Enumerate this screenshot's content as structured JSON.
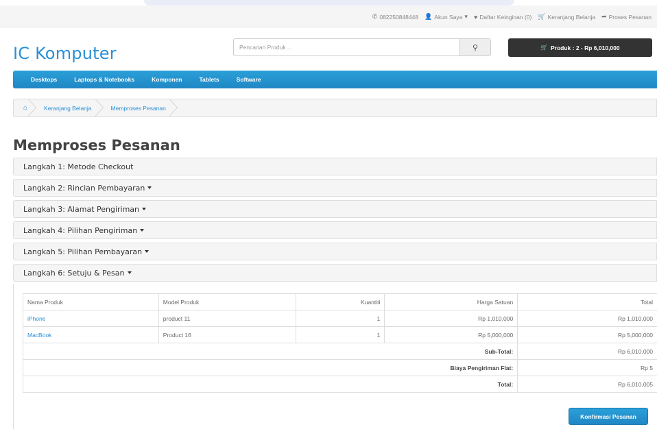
{
  "topbar": {
    "phone": "082250848448",
    "account": "Akun Saya",
    "wishlist": "Daftar Keinginan (0)",
    "cart": "Keranjang Belanja",
    "checkout": "Proses Pesanan"
  },
  "header": {
    "logo": "IC Komputer",
    "search_placeholder": "Pencarian Produk ...",
    "cart_summary": "Produk : 2 - Rp 6,010,000"
  },
  "menu": [
    "Desktops",
    "Laptops & Notebooks",
    "Komponen",
    "Tablets",
    "Software"
  ],
  "breadcrumb": [
    "Keranjang Belanja",
    "Memproses Pesanan"
  ],
  "page_title": "Memproses Pesanan",
  "steps": [
    {
      "label": "Langkah 1: Metode Checkout"
    },
    {
      "label": "Langkah 2: Rincian Pembayaran"
    },
    {
      "label": "Langkah 3: Alamat Pengiriman"
    },
    {
      "label": "Langkah 4: Pilihan Pengiriman"
    },
    {
      "label": "Langkah 5: Pilihan Pembayaran"
    },
    {
      "label": "Langkah 6: Setuju & Pesan"
    }
  ],
  "table": {
    "headers": [
      "Nama Produk",
      "Model Produk",
      "Kuantiti",
      "Harga Satuan",
      "Total"
    ],
    "rows": [
      {
        "name": "iPhone",
        "model": "product 11",
        "qty": "1",
        "price": "Rp 1,010,000",
        "total": "Rp 1,010,000"
      },
      {
        "name": "MacBook",
        "model": "Product 16",
        "qty": "1",
        "price": "Rp 5,000,000",
        "total": "Rp 5,000,000"
      }
    ],
    "totals": [
      {
        "label": "Sub-Total:",
        "value": "Rp 6,010,000"
      },
      {
        "label": "Biaya Pengiriman Flat:",
        "value": "Rp 5"
      },
      {
        "label": "Total:",
        "value": "Rp 6,010,005"
      }
    ]
  },
  "confirm_label": "Konfirmasi Pesanan"
}
